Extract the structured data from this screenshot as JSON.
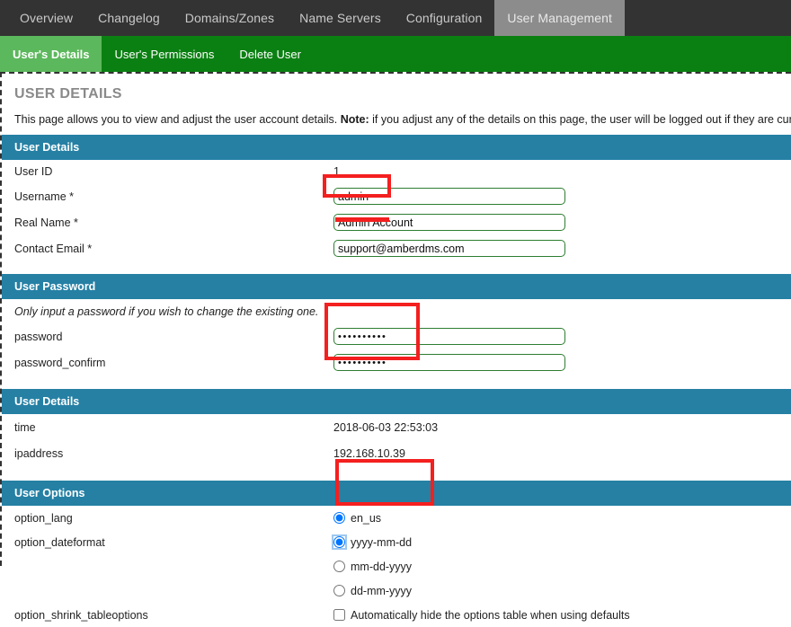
{
  "topnav": {
    "items": [
      {
        "label": "Overview",
        "active": false
      },
      {
        "label": "Changelog",
        "active": false
      },
      {
        "label": "Domains/Zones",
        "active": false
      },
      {
        "label": "Name Servers",
        "active": false
      },
      {
        "label": "Configuration",
        "active": false
      },
      {
        "label": "User Management",
        "active": true
      }
    ]
  },
  "subnav": {
    "items": [
      {
        "label": "User's Details",
        "active": true
      },
      {
        "label": "User's Permissions",
        "active": false
      },
      {
        "label": "Delete User",
        "active": false
      }
    ]
  },
  "page": {
    "title": "USER DETAILS",
    "intro_part1": "This page allows you to view and adjust the user account details. ",
    "intro_note": "Note:",
    "intro_part2": " if you adjust any of the details on this page, the user will be logged out if they are cur"
  },
  "sections": {
    "user_details": {
      "heading": "User Details",
      "rows": [
        {
          "label": "User ID",
          "value": "1"
        }
      ],
      "fields": [
        {
          "label": "Username *",
          "value": "admin"
        },
        {
          "label": "Real Name *",
          "value": "Admin Account"
        },
        {
          "label": "Contact Email *",
          "value": "support@amberdms.com"
        }
      ]
    },
    "user_password": {
      "heading": "User Password",
      "note": "Only input a password if you wish to change the existing one.",
      "fields": [
        {
          "label": "password",
          "value": "••••••••••"
        },
        {
          "label": "password_confirm",
          "value": "••••••••••"
        }
      ]
    },
    "user_details_meta": {
      "heading": "User Details",
      "rows": [
        {
          "label": "time",
          "value": "2018-06-03 22:53:03"
        },
        {
          "label": "ipaddress",
          "value": "192.168.10.39"
        }
      ]
    },
    "user_options": {
      "heading": "User Options",
      "option_lang": {
        "label": "option_lang",
        "choices": [
          {
            "label": "en_us",
            "checked": true,
            "focused": false
          }
        ]
      },
      "option_dateformat": {
        "label": "option_dateformat",
        "choices": [
          {
            "label": "yyyy-mm-dd",
            "checked": true,
            "focused": true
          },
          {
            "label": "mm-dd-yyyy",
            "checked": false,
            "focused": false
          },
          {
            "label": "dd-mm-yyyy",
            "checked": false,
            "focused": false
          }
        ]
      },
      "option_shrink": {
        "label": "option_shrink_tableoptions",
        "choice": {
          "label": "Automatically hide the options table when using defaults",
          "checked": false
        }
      }
    }
  },
  "colors": {
    "topnav_bg": "#333333",
    "topnav_active_bg": "#8c8c8c",
    "subnav_bg": "#0b8012",
    "subnav_active_bg": "#5cb85c",
    "section_header_bg": "#2580a4",
    "field_border": "#2e7d32",
    "annotation": "#f41f1f"
  }
}
